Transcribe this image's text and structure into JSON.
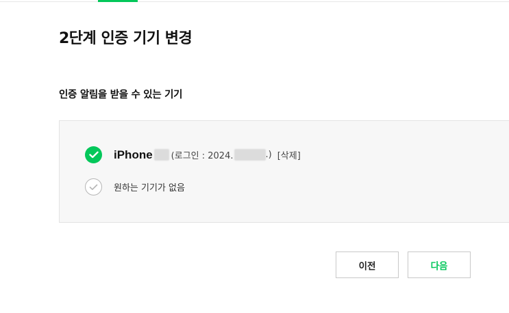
{
  "title": "2단계 인증 기기 변경",
  "section_title": "인증 알림을 받을 수 있는 기기",
  "devices": [
    {
      "name": "iPhone",
      "login_prefix": "(로그인 : 2024.",
      "login_suffix": ".)",
      "delete_label": "[삭제]",
      "selected": true
    }
  ],
  "no_device_label": "원하는 기기가 없음",
  "buttons": {
    "prev_label": "이전",
    "next_label": "다음"
  },
  "colors": {
    "accent": "#03c75a",
    "box_background": "#f7f7f7",
    "border": "#e3e3e3"
  },
  "icons": {
    "selected": "check-circle-filled-icon",
    "unselected": "check-circle-outline-icon"
  }
}
